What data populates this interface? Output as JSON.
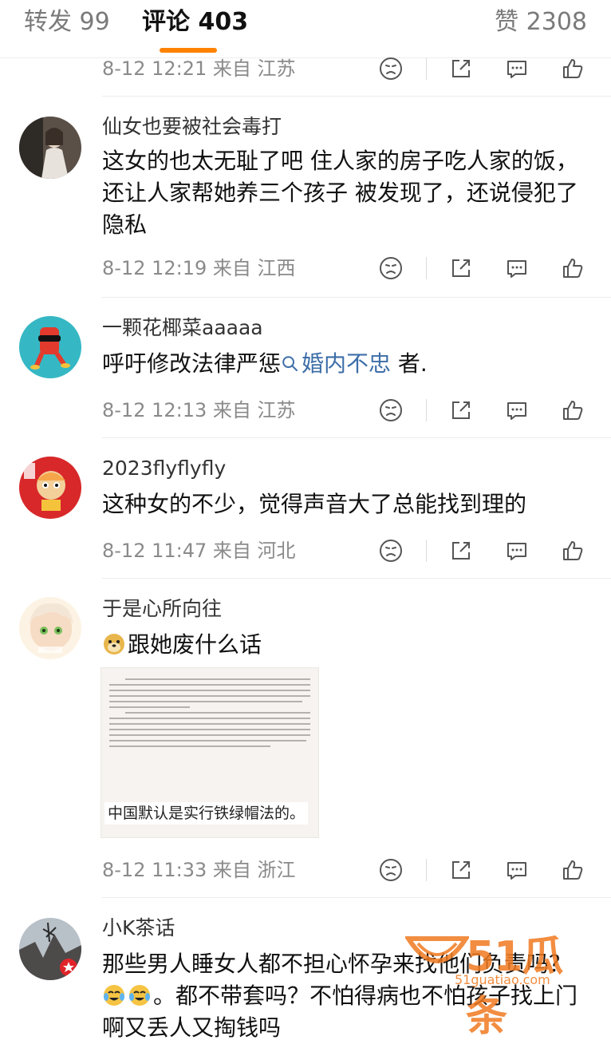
{
  "tabs": {
    "repost": "转发 99",
    "comments": "评论 403",
    "likes": "赞 2308"
  },
  "colors": {
    "accent": "#ff8200",
    "link": "#3d6ea8"
  },
  "top_meta": {
    "time": "8-12 12:21  来自 江苏"
  },
  "comments": [
    {
      "user": "仙女也要被社会毒打",
      "text": "这女的也太无耻了吧 住人家的房子吃人家的饭，还让人家帮她养三个孩子 被发现了，还说侵犯了隐私",
      "meta": "8-12 12:19  来自 江西"
    },
    {
      "user": "一颗花椰菜aaaaa",
      "text_before": "呼吁修改法律严惩",
      "link": "婚内不忠",
      "text_after": " 者.",
      "meta": "8-12 12:13  来自 江苏"
    },
    {
      "user": "2023flyflyfly",
      "text": "这种女的不少，觉得声音大了总能找到理的",
      "meta": "8-12 11:47  来自 河北"
    },
    {
      "user": "于是心所向往",
      "text": "跟她废什么话",
      "image_caption": "中国默认是实行铁绿帽法的。",
      "meta": "8-12 11:33  来自 浙江"
    },
    {
      "user": "小K茶话",
      "text": "那些男人睡女人都不担心怀孕来找他们负责吗？",
      "text2": "。都不带套吗？不怕得病也不怕孩子找上门啊又丢人又掏钱吗"
    }
  ],
  "watermark": {
    "brand": "51瓜条",
    "url": "51guatiao.com"
  },
  "icons": [
    "dislike-icon",
    "share-icon",
    "reply-icon",
    "like-icon",
    "search-icon"
  ]
}
